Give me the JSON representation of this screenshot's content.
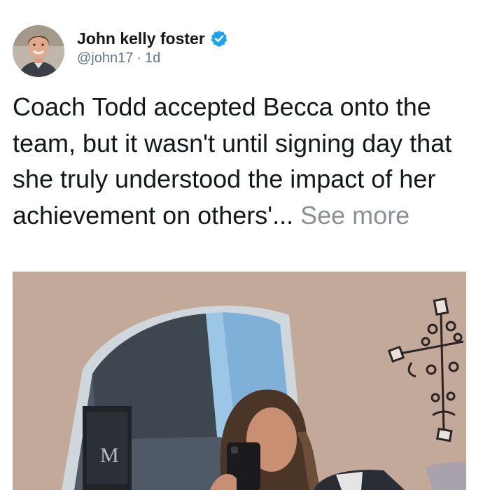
{
  "tweet": {
    "author": {
      "display_name": "John kelly foster",
      "handle": "@john17",
      "time_sep": "·",
      "time": "1d",
      "verified_icon": "verified-badge-icon",
      "verified_color": "#1da1f2"
    },
    "text": "Coach Todd accepted Becca onto the team, but it wasn't until signing day that she truly understood the impact of her achievement on others'...",
    "see_more_label": "See more",
    "photo_sign_letter": "M"
  },
  "colors": {
    "text_primary": "#14171a",
    "text_secondary": "#657786",
    "see_more": "#8a8f94",
    "wall": "#c6ad9d",
    "mirror_frame": "#cfd6dc"
  }
}
